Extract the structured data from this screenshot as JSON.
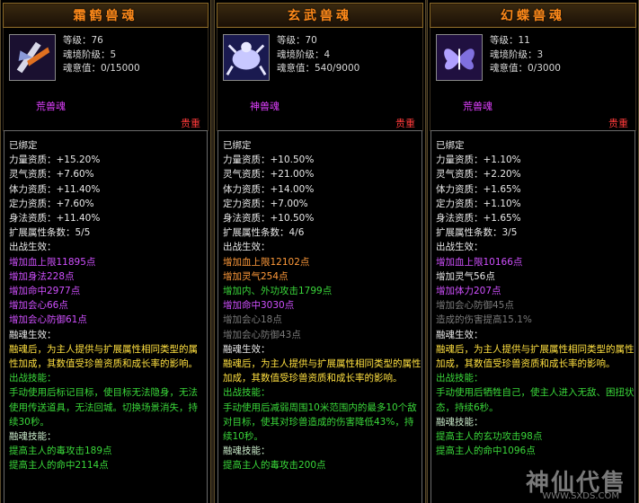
{
  "panels": [
    {
      "title": "霜鹤兽魂",
      "icon": "crane-beast-soul-icon",
      "stats": [
        "等级：76",
        "魂境阶级：5",
        "魂意值：0/15000"
      ],
      "kind": "荒兽魂",
      "rarity": "贵重",
      "lines": [
        {
          "t": "已绑定",
          "c": "white"
        },
        {
          "t": "力量资质：+15.20%",
          "c": "white"
        },
        {
          "t": "灵气资质：+7.60%",
          "c": "white"
        },
        {
          "t": "体力资质：+11.40%",
          "c": "white"
        },
        {
          "t": "定力资质：+7.60%",
          "c": "white"
        },
        {
          "t": "身法资质：+11.40%",
          "c": "white"
        },
        {
          "t": "扩展属性条数：5/5",
          "c": "white"
        },
        {
          "t": "出战生效：",
          "c": "white"
        },
        {
          "t": "增加血上限11895点",
          "c": "purple"
        },
        {
          "t": "增加身法228点",
          "c": "purple"
        },
        {
          "t": "增加命中2977点",
          "c": "purple"
        },
        {
          "t": "增加会心66点",
          "c": "purple"
        },
        {
          "t": "增加会心防御61点",
          "c": "purple"
        },
        {
          "t": "融魂生效：",
          "c": "white"
        },
        {
          "t": "融魂后，为主人提供与扩展属性相同类型的属性加成，其数值受珍兽资质和成长率的影响。",
          "c": "yellow",
          "para": true
        },
        {
          "t": "出战技能：",
          "c": "green"
        },
        {
          "t": "手动使用后标记目标，使目标无法隐身，无法使用传送道具，无法回城。切换场景消失，持续30秒。",
          "c": "green",
          "para": true
        },
        {
          "t": "融魂技能：",
          "c": "ltgreen"
        },
        {
          "t": "提高主人的毒攻击189点",
          "c": "green"
        },
        {
          "t": "提高主人的命中2114点",
          "c": "green"
        }
      ]
    },
    {
      "title": "玄武兽魂",
      "icon": "tortoise-beast-soul-icon",
      "stats": [
        "等级：70",
        "魂境阶级：4",
        "魂意值：540/9000"
      ],
      "kind": "神兽魂",
      "rarity": "贵重",
      "lines": [
        {
          "t": "已绑定",
          "c": "white"
        },
        {
          "t": "力量资质：+10.50%",
          "c": "white"
        },
        {
          "t": "灵气资质：+21.00%",
          "c": "white"
        },
        {
          "t": "体力资质：+14.00%",
          "c": "white"
        },
        {
          "t": "定力资质：+7.00%",
          "c": "white"
        },
        {
          "t": "身法资质：+10.50%",
          "c": "white"
        },
        {
          "t": "扩展属性条数：4/6",
          "c": "white"
        },
        {
          "t": "出战生效：",
          "c": "white"
        },
        {
          "t": "增加血上限12102点",
          "c": "orange"
        },
        {
          "t": "增加灵气254点",
          "c": "orange"
        },
        {
          "t": "增加内、外功攻击1799点",
          "c": "green"
        },
        {
          "t": "增加命中3030点",
          "c": "purple"
        },
        {
          "t": "增加会心18点",
          "c": "gray"
        },
        {
          "t": "增加会心防御43点",
          "c": "gray"
        },
        {
          "t": "融魂生效：",
          "c": "white"
        },
        {
          "t": "融魂后，为主人提供与扩展属性相同类型的属性加成，其数值受珍兽资质和成长率的影响。",
          "c": "yellow",
          "para": true
        },
        {
          "t": "出战技能：",
          "c": "green"
        },
        {
          "t": "手动使用后减弱周围10米范围内的最多10个敌对目标，使其对珍兽造成的伤害降低43%，持续10秒。",
          "c": "green",
          "para": true
        },
        {
          "t": "融魂技能：",
          "c": "ltgreen"
        },
        {
          "t": "提高主人的毒攻击200点",
          "c": "green"
        }
      ]
    },
    {
      "title": "幻蝶兽魂",
      "icon": "butterfly-beast-soul-icon",
      "stats": [
        "等级：11",
        "魂境阶级：3",
        "魂意值：0/3000"
      ],
      "kind": "荒兽魂",
      "rarity": "贵重",
      "lines": [
        {
          "t": "已绑定",
          "c": "white"
        },
        {
          "t": "力量资质：+1.10%",
          "c": "white"
        },
        {
          "t": "灵气资质：+2.20%",
          "c": "white"
        },
        {
          "t": "体力资质：+1.65%",
          "c": "white"
        },
        {
          "t": "定力资质：+1.10%",
          "c": "white"
        },
        {
          "t": "身法资质：+1.65%",
          "c": "white"
        },
        {
          "t": "扩展属性条数：3/5",
          "c": "white"
        },
        {
          "t": "出战生效：",
          "c": "white"
        },
        {
          "t": "增加血上限10166点",
          "c": "purple"
        },
        {
          "t": "增加灵气56点",
          "c": "white"
        },
        {
          "t": "增加体力207点",
          "c": "purple"
        },
        {
          "t": "增加会心防御45点",
          "c": "gray"
        },
        {
          "t": "造成的伤害提高15.1%",
          "c": "gray"
        },
        {
          "t": "融魂生效：",
          "c": "white"
        },
        {
          "t": "融魂后，为主人提供与扩展属性相同类型的属性加成，其数值受珍兽资质和成长率的影响。",
          "c": "yellow",
          "para": true
        },
        {
          "t": "出战技能：",
          "c": "green"
        },
        {
          "t": "手动使用后牺牲自己，使主人进入无敌、困扭状态，持续6秒。",
          "c": "green",
          "para": true
        },
        {
          "t": "融魂技能：",
          "c": "ltgreen"
        },
        {
          "t": "提高主人的玄功攻击98点",
          "c": "green"
        },
        {
          "t": "提高主人的命中1096点",
          "c": "green"
        }
      ]
    }
  ],
  "watermark": {
    "text": "神仙代售",
    "sub": "WWW.SXDS.COM"
  }
}
